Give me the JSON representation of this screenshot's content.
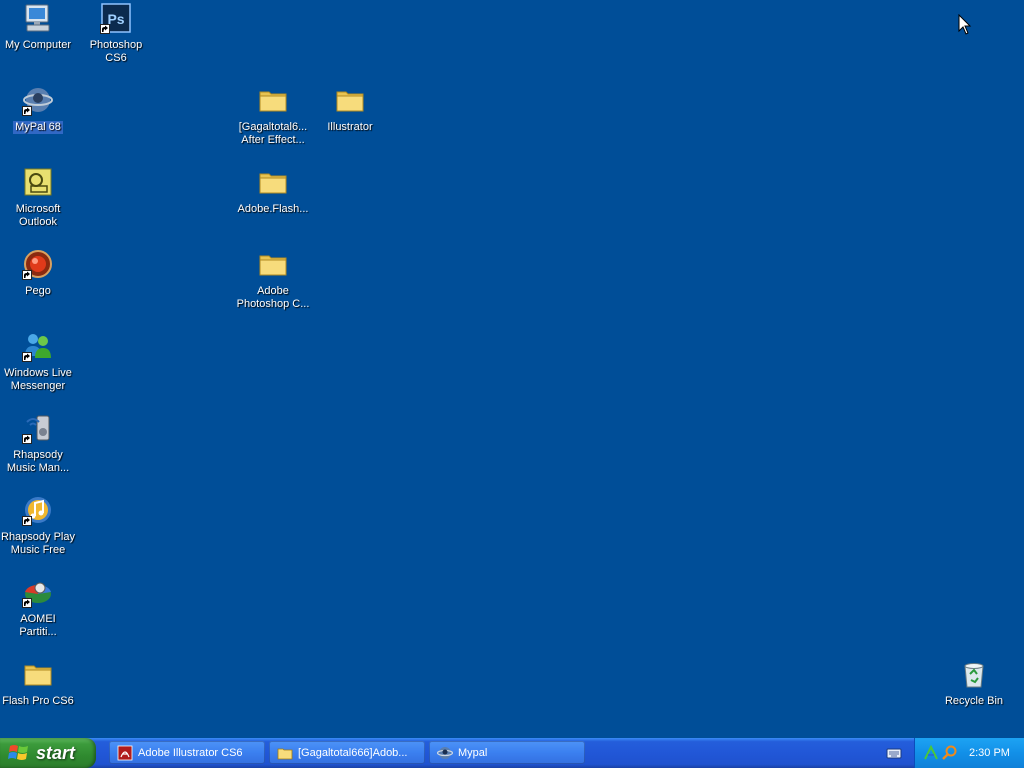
{
  "desktop": {
    "background": "#004e98",
    "icons": [
      {
        "id": "my-computer",
        "label": "My Computer",
        "icon": "computer-icon",
        "shortcut": false,
        "selected": false
      },
      {
        "id": "photoshop-cs6",
        "label": "Photoshop CS6",
        "icon": "photoshop-icon",
        "shortcut": true,
        "selected": false
      },
      {
        "id": "mypal-68",
        "label": "MyPal 68",
        "icon": "mypal-icon",
        "shortcut": true,
        "selected": true
      },
      {
        "id": "gagaltotal-folder",
        "label": "[Gagaltotal6...\nAfter Effect...",
        "icon": "folder-icon",
        "shortcut": false,
        "selected": false
      },
      {
        "id": "illustrator-folder",
        "label": "Illustrator",
        "icon": "folder-icon",
        "shortcut": false,
        "selected": false
      },
      {
        "id": "microsoft-outlook",
        "label": "Microsoft\nOutlook",
        "icon": "outlook-icon",
        "shortcut": false,
        "selected": false
      },
      {
        "id": "adobe-flash-folder",
        "label": "Adobe.Flash...",
        "icon": "folder-icon",
        "shortcut": false,
        "selected": false
      },
      {
        "id": "pego",
        "label": "Pego",
        "icon": "pego-icon",
        "shortcut": true,
        "selected": false
      },
      {
        "id": "adobe-photoshop-folder",
        "label": "Adobe\nPhotoshop C...",
        "icon": "folder-icon",
        "shortcut": false,
        "selected": false
      },
      {
        "id": "windows-live-messenger",
        "label": "Windows Live\nMessenger",
        "icon": "messenger-icon",
        "shortcut": true,
        "selected": false
      },
      {
        "id": "rhapsody-music-manager",
        "label": "Rhapsody\nMusic Man...",
        "icon": "rhapsody-icon",
        "shortcut": true,
        "selected": false
      },
      {
        "id": "rhapsody-play-music",
        "label": "Rhapsody Play\nMusic Free",
        "icon": "music-note-icon",
        "shortcut": true,
        "selected": false
      },
      {
        "id": "aomei-partition",
        "label": "AOMEI\nPartiti...",
        "icon": "aomei-icon",
        "shortcut": true,
        "selected": false
      },
      {
        "id": "flash-pro-cs6",
        "label": "Flash Pro CS6",
        "icon": "folder-icon",
        "shortcut": false,
        "selected": false
      },
      {
        "id": "recycle-bin",
        "label": "Recycle Bin",
        "icon": "recycle-bin-icon",
        "shortcut": false,
        "selected": false
      }
    ]
  },
  "taskbar": {
    "start_label": "start",
    "tasks": [
      {
        "label": "Adobe Illustrator CS6",
        "icon": "acrobat-icon"
      },
      {
        "label": "[Gagaltotal666]Adob...",
        "icon": "folder-icon"
      },
      {
        "label": "Mypal",
        "icon": "mypal-icon"
      }
    ],
    "tray": {
      "icons": [
        "network-icon",
        "search-icon"
      ],
      "clock": "2:30 PM"
    }
  },
  "colors": {
    "taskbar_blue": "#245edb",
    "start_green": "#3c9b3c",
    "tray_blue": "#1290e8",
    "selection": "#3168c5"
  }
}
